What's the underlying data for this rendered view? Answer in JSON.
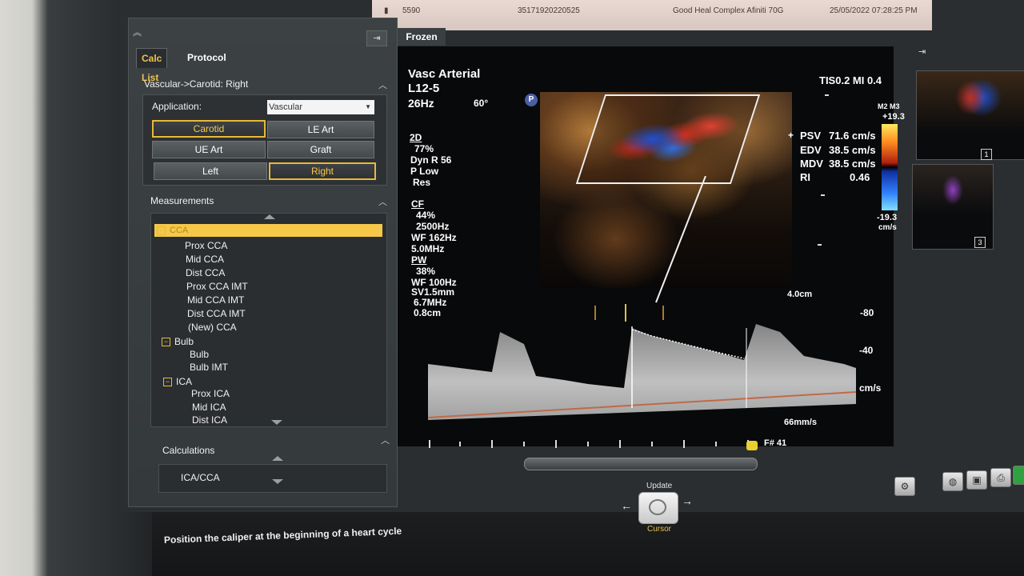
{
  "topbar": {
    "id_left": "5590",
    "patient_id": "35171920220525",
    "site": "Good Heal Complex  Afiniti 70G",
    "datetime": "25/05/2022  07:28:25 PM"
  },
  "tabs": {
    "calc_list": "Calc List",
    "protocol": "Protocol"
  },
  "protocol_group": {
    "title": "Vascular->Carotid: Right",
    "application_label": "Application:",
    "application_value": "Vascular"
  },
  "buttons": {
    "carotid": "Carotid",
    "le_art": "LE Art",
    "ue_art": "UE Art",
    "graft": "Graft",
    "left": "Left",
    "right": "Right"
  },
  "measurements": {
    "title": "Measurements",
    "items": [
      {
        "label": "CCA"
      },
      {
        "label": "Prox CCA"
      },
      {
        "label": "Mid CCA"
      },
      {
        "label": "Dist CCA"
      },
      {
        "label": "Prox CCA IMT"
      },
      {
        "label": "Mid CCA IMT"
      },
      {
        "label": "Dist CCA IMT"
      },
      {
        "label": "(New) CCA"
      },
      {
        "label": "Bulb"
      },
      {
        "label": "Bulb"
      },
      {
        "label": "Bulb IMT"
      },
      {
        "label": "ICA"
      },
      {
        "label": "Prox ICA"
      },
      {
        "label": "Mid ICA"
      },
      {
        "label": "Dist ICA"
      }
    ]
  },
  "calculations": {
    "title": "Calculations",
    "item": "ICA/CCA"
  },
  "image": {
    "frozen": "Frozen",
    "preset": "Vasc Arterial",
    "probe": "L12-5",
    "frame_rate": "26Hz",
    "angle": "60°",
    "probe_marker": "P",
    "tis_mi": "TIS0.2  MI 0.4",
    "mode_2d": {
      "title": "2D",
      "gain": "77%",
      "dyn": "Dyn R 56",
      "persist": "P Low",
      "res": "Res"
    },
    "cf": {
      "title": "CF",
      "gain": "44%",
      "prf": "2500Hz",
      "wf": "WF 162Hz",
      "freq": "5.0MHz"
    },
    "pw": {
      "title": "PW",
      "gain": "38%",
      "wf": "WF 100Hz",
      "sv": "SV1.5mm",
      "freq": "6.7MHz",
      "depth": "0.8cm"
    },
    "measures": [
      {
        "label": "PSV",
        "value": "71.6 cm/s"
      },
      {
        "label": "EDV",
        "value": "38.5 cm/s"
      },
      {
        "label": "MDV",
        "value": "38.5 cm/s"
      },
      {
        "label": "RI",
        "value": "0.46"
      }
    ],
    "colorbar": {
      "mode": "M2 M3",
      "top": "+19.3",
      "bottom": "-19.3",
      "unit": "cm/s"
    },
    "depth": "4.0cm",
    "doppler_scale": {
      "v80": "-80",
      "v40": "-40",
      "unit": "cm/s"
    },
    "sweep": "66mm/s",
    "frame": "F# 41"
  },
  "thumbnails": {
    "t1": "1",
    "t2": "3"
  },
  "controls": {
    "update": "Update",
    "cursor": "Cursor"
  },
  "status": "Position the caliper at the beginning of a heart cycle"
}
